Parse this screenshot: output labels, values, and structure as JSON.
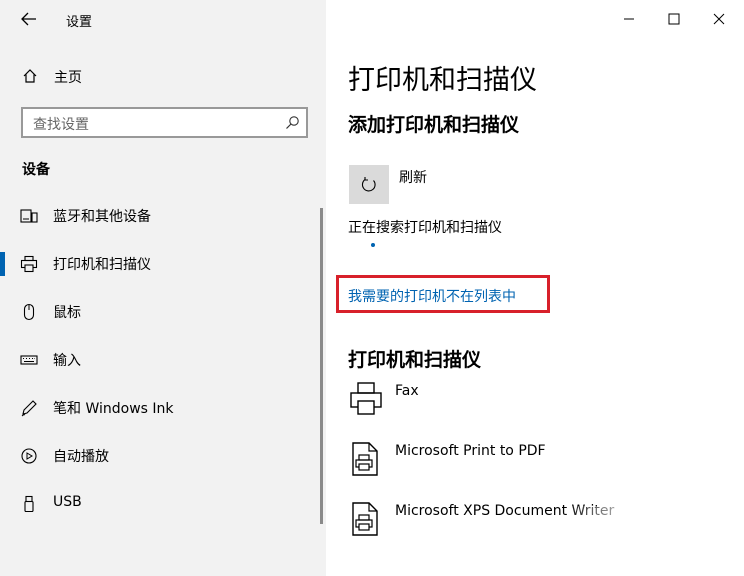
{
  "window": {
    "app_title": "设置",
    "controls": {
      "minimize": "minimize",
      "maximize": "maximize",
      "close": "close"
    }
  },
  "sidebar": {
    "home_label": "主页",
    "search_placeholder": "查找设置",
    "section_title": "设备",
    "items": [
      {
        "label": "蓝牙和其他设备",
        "icon": "bluetooth-devices-icon",
        "active": false
      },
      {
        "label": "打印机和扫描仪",
        "icon": "printer-icon",
        "active": true
      },
      {
        "label": "鼠标",
        "icon": "mouse-icon",
        "active": false
      },
      {
        "label": "输入",
        "icon": "keyboard-icon",
        "active": false
      },
      {
        "label": "笔和 Windows Ink",
        "icon": "pen-icon",
        "active": false
      },
      {
        "label": "自动播放",
        "icon": "autoplay-icon",
        "active": false
      },
      {
        "label": "USB",
        "icon": "usb-icon",
        "active": false
      }
    ]
  },
  "main": {
    "page_title": "打印机和扫描仪",
    "add_title": "添加打印机和扫描仪",
    "refresh_label": "刷新",
    "searching_text": "正在搜索打印机和扫描仪",
    "not_listed_link": "我需要的打印机不在列表中",
    "devices_title": "打印机和扫描仪",
    "devices": [
      {
        "name": "Fax",
        "icon": "fax-icon"
      },
      {
        "name": "Microsoft Print to PDF",
        "icon": "document-printer-icon"
      },
      {
        "name": "Microsoft XPS Document Writer",
        "icon": "document-printer-icon"
      }
    ]
  },
  "colors": {
    "accent": "#0063b1",
    "highlight_box": "#d8202a",
    "sidebar_bg": "#f2f2f2"
  }
}
